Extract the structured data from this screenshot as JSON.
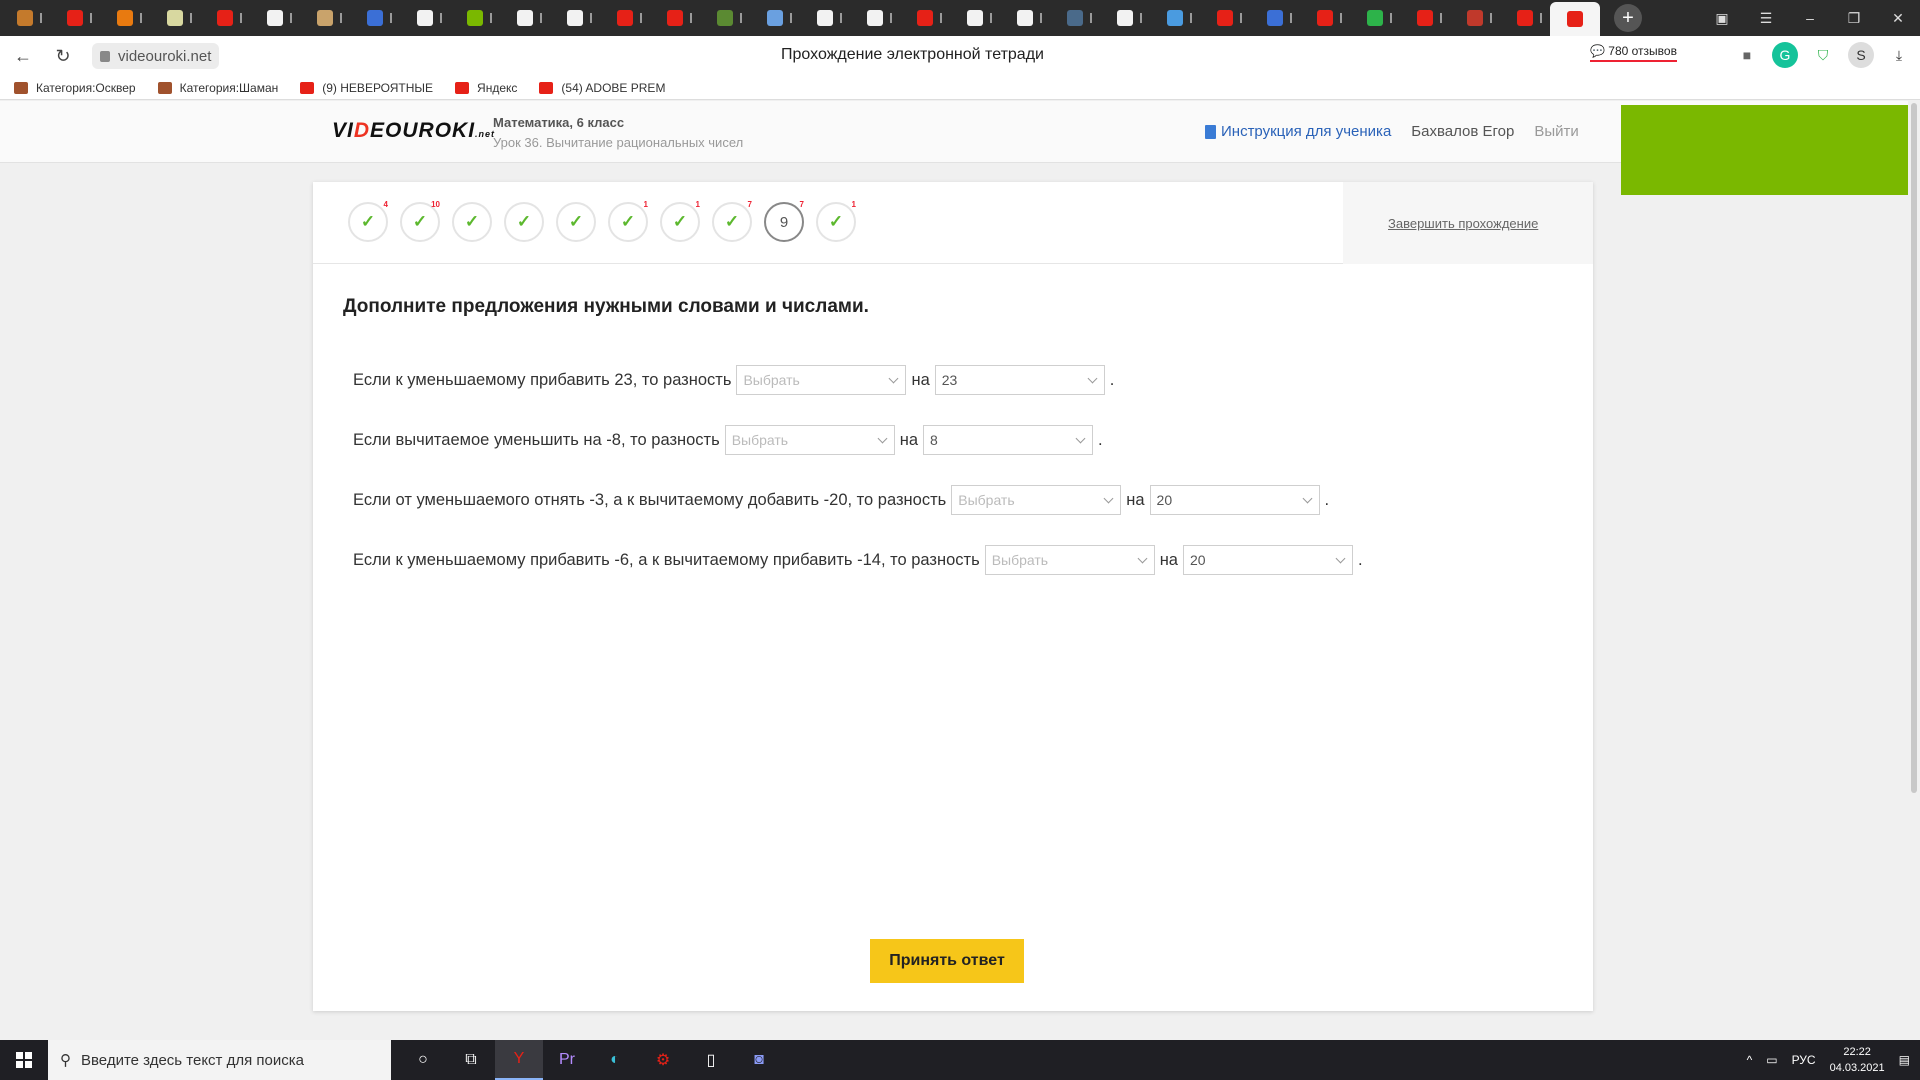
{
  "browser": {
    "tabs": [
      {
        "icon": "cat-icon",
        "color": "#c47a2c"
      },
      {
        "icon": "youtube-icon",
        "color": "#e62117"
      },
      {
        "icon": "target-icon",
        "color": "#e87a10"
      },
      {
        "icon": "ball-icon",
        "color": "#d8d8a0"
      },
      {
        "icon": "huawei-icon",
        "color": "#e62117"
      },
      {
        "icon": "v-icon",
        "color": "#f2f2f2"
      },
      {
        "icon": "box-icon",
        "color": "#c9a36b"
      },
      {
        "icon": "c-icon",
        "color": "#3b6fd6"
      },
      {
        "icon": "doc-icon",
        "color": "#f2f2f2"
      },
      {
        "icon": "grid-icon",
        "color": "#7ab800"
      },
      {
        "icon": "plus-icon",
        "color": "#f2f2f2"
      },
      {
        "icon": "quote-icon",
        "color": "#f2f2f2"
      },
      {
        "icon": "youtube-icon",
        "color": "#e62117"
      },
      {
        "icon": "yandex-icon",
        "color": "#e62117"
      },
      {
        "icon": "minecraft-icon",
        "color": "#5b8a32"
      },
      {
        "icon": "wave-icon",
        "color": "#6aa0e0"
      },
      {
        "icon": "quote-icon",
        "color": "#f2f2f2"
      },
      {
        "icon": "plus-icon",
        "color": "#f2f2f2"
      },
      {
        "icon": "youtube-icon",
        "color": "#e62117"
      },
      {
        "icon": "chat-icon",
        "color": "#f2f2f2"
      },
      {
        "icon": "chat-icon",
        "color": "#f2f2f2"
      },
      {
        "icon": "image-icon",
        "color": "#4a6a8a"
      },
      {
        "icon": "dots-icon",
        "color": "#f2f2f2"
      },
      {
        "icon": "globe-icon",
        "color": "#4a9be0"
      },
      {
        "icon": "youtube-icon",
        "color": "#e62117"
      },
      {
        "icon": "feather-icon",
        "color": "#3b6fd6"
      },
      {
        "icon": "youtube-icon",
        "color": "#e62117"
      },
      {
        "icon": "circle-icon",
        "color": "#2db34a"
      },
      {
        "icon": "yandex-icon",
        "color": "#e62117"
      },
      {
        "icon": "book-icon",
        "color": "#c0392b"
      },
      {
        "icon": "play-icon",
        "color": "#e62117"
      },
      {
        "icon": "videouroki-icon",
        "color": "#e62117",
        "active": true
      }
    ],
    "url": "videouroki.net",
    "page_title": "Прохождение электронной тетради",
    "reviews": "780 отзывов",
    "bookmarks": [
      {
        "label": "Категория:Осквер",
        "color": "#a0522d"
      },
      {
        "label": "Категория:Шаман",
        "color": "#a0522d"
      },
      {
        "label": "(9) НЕВЕРОЯТНЫЕ",
        "color": "#e62117"
      },
      {
        "label": "Яндекс",
        "color": "#e62117"
      },
      {
        "label": "(54) ADOBE PREM",
        "color": "#e62117"
      }
    ]
  },
  "site": {
    "logo_pre": "VI",
    "logo_accent": "D",
    "logo_post": "EOUROKI",
    "logo_suffix": ".net",
    "subject": "Математика, 6 класс",
    "lesson": "Урок 36. Вычитание рациональных чисел",
    "instruction_link": "Инструкция для ученика",
    "user_name": "Бахвалов Егор",
    "logout": "Выйти"
  },
  "progress": {
    "steps": [
      {
        "state": "done",
        "badge": "4"
      },
      {
        "state": "done",
        "badge": "10"
      },
      {
        "state": "done",
        "badge": ""
      },
      {
        "state": "done",
        "badge": ""
      },
      {
        "state": "done",
        "badge": ""
      },
      {
        "state": "done",
        "badge": "1"
      },
      {
        "state": "done",
        "badge": "1"
      },
      {
        "state": "done",
        "badge": "7"
      },
      {
        "state": "current",
        "label": "9",
        "badge": "7"
      },
      {
        "state": "done",
        "badge": "1"
      }
    ],
    "finish_link": "Завершить прохождение"
  },
  "task": {
    "title": "Дополните предложения нужными словами и числами.",
    "connector": "на",
    "rows": [
      {
        "text": "Если к уменьшаемому прибавить 23, то разность",
        "select1": "Выбрать",
        "select2": "23"
      },
      {
        "text": "Если вычитаемое уменьшить на -8, то разность",
        "select1": "Выбрать",
        "select2": "8"
      },
      {
        "text": "Если от уменьшаемого отнять -3, а к вычитаемому добавить -20, то разность",
        "select1": "Выбрать",
        "select2": "20"
      },
      {
        "text": "Если к уменьшаемому прибавить -6, а к вычитаемому прибавить -14, то разность",
        "select1": "Выбрать",
        "select2": "20"
      }
    ],
    "submit": "Принять ответ"
  },
  "taskbar": {
    "search_placeholder": "Введите здесь текст для поиска",
    "lang": "РУС",
    "time": "22:22",
    "date": "04.03.2021"
  },
  "colors": {
    "accent_green": "#7ab800",
    "submit_yellow": "#f6c619",
    "check_green": "#5cb82e",
    "link_blue": "#2a62b8"
  }
}
